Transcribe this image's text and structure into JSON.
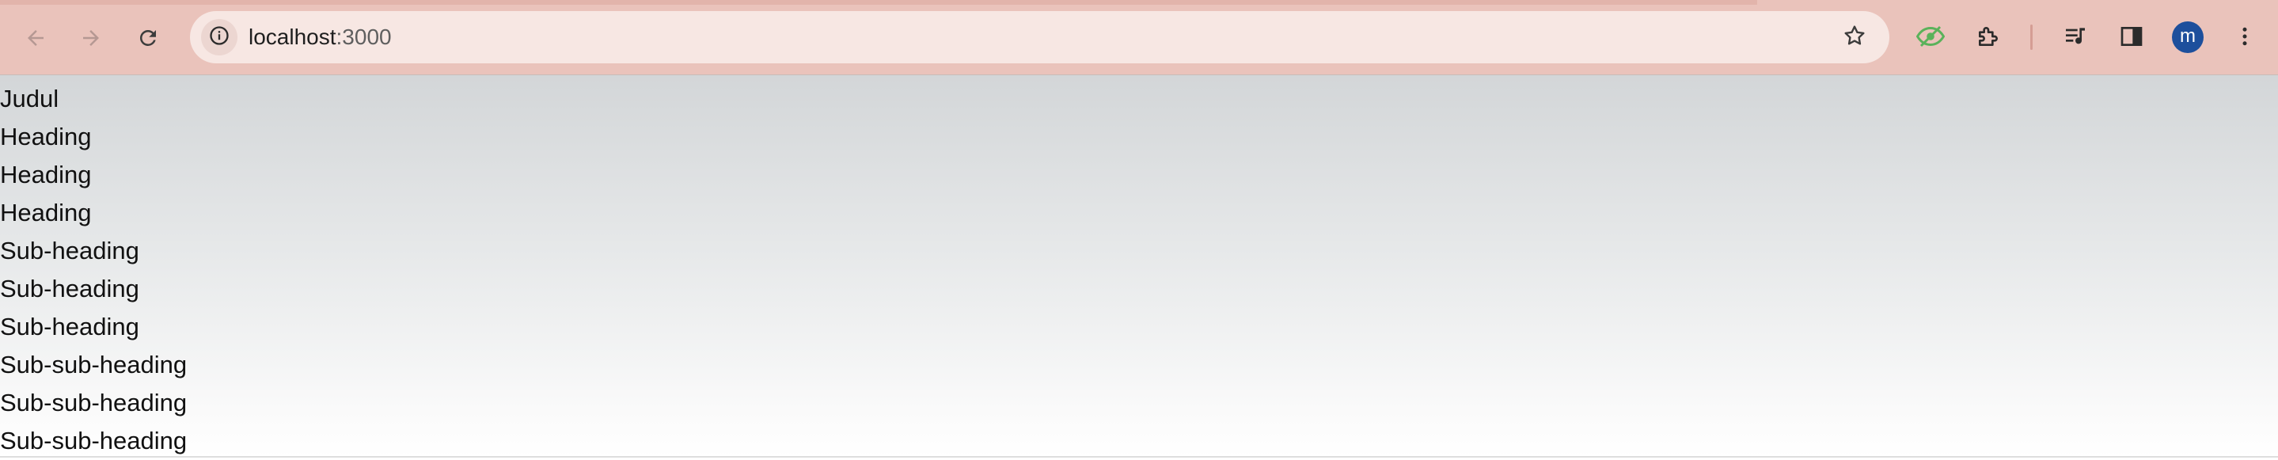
{
  "browser": {
    "url_host": "localhost",
    "url_port": ":3000",
    "avatar_initial": "m",
    "icons": {
      "back": "arrow-left-icon",
      "forward": "arrow-right-icon",
      "reload": "reload-icon",
      "site_info": "info-icon",
      "bookmark": "star-icon",
      "extension_eye": "eye-slash-icon",
      "extensions": "puzzle-icon",
      "media": "media-control-icon",
      "side_panel": "side-panel-icon",
      "menu": "kebab-menu-icon"
    },
    "colors": {
      "toolbar": "#eac3bb",
      "omnibox": "#f7e7e3",
      "avatar": "#1d4f9c",
      "eye_extension": "#5ab25a"
    }
  },
  "page": {
    "lines": [
      "Judul",
      "Heading",
      "Heading",
      "Heading",
      "Sub-heading",
      "Sub-heading",
      "Sub-heading",
      "Sub-sub-heading",
      "Sub-sub-heading",
      "Sub-sub-heading"
    ]
  }
}
